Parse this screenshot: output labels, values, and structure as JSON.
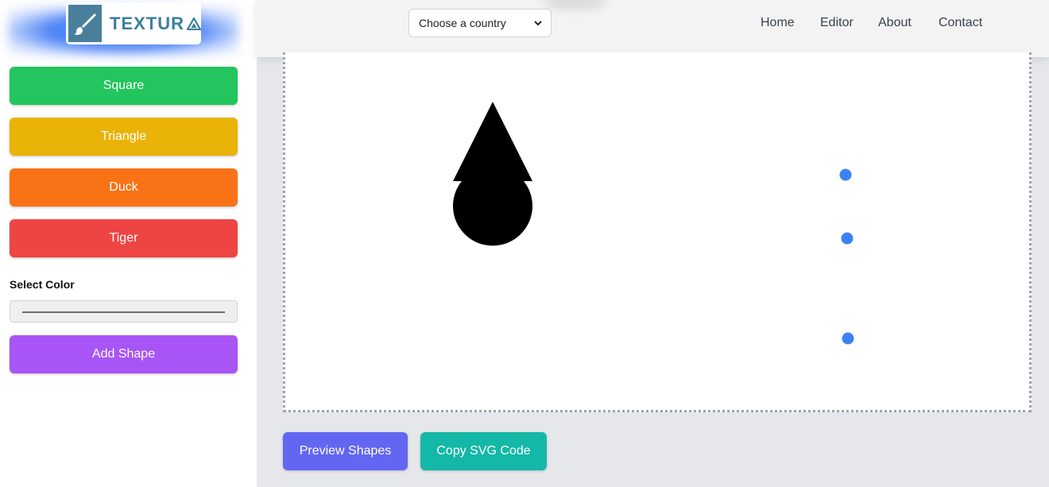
{
  "app": {
    "logo_text": "TEXTUR"
  },
  "sidebar": {
    "buttons": [
      {
        "label": "Square",
        "color": "#22c55e"
      },
      {
        "label": "Triangle",
        "color": "#eab308"
      },
      {
        "label": "Duck",
        "color": "#f97316"
      },
      {
        "label": "Tiger",
        "color": "#ef4444"
      }
    ],
    "select_color_label": "Select Color",
    "add_shape_label": "Add Shape",
    "add_shape_color": "#a855f7"
  },
  "header": {
    "country_select_value": "Choose a country",
    "nav": [
      "Home",
      "Editor",
      "About",
      "Contact"
    ]
  },
  "footer_buttons": {
    "preview_label": "Preview Shapes",
    "preview_color": "#6366f1",
    "copy_label": "Copy SVG Code",
    "copy_color": "#14b8a6"
  },
  "canvas": {
    "shape_fill": "#000000",
    "point_color": "#3b82f6"
  }
}
